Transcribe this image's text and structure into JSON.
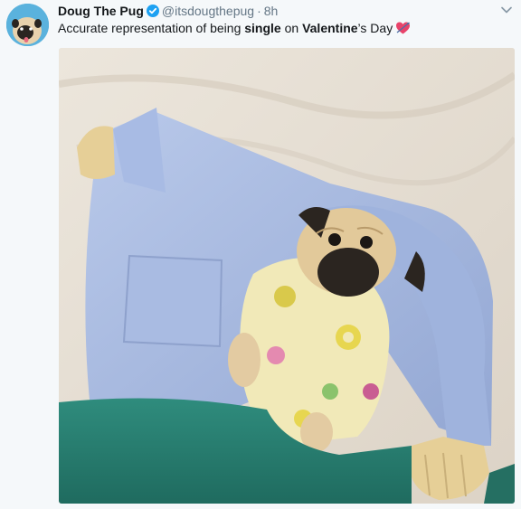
{
  "tweet": {
    "display_name": "Doug The Pug",
    "handle": "@itsdougthepug",
    "separator": "·",
    "time": "8h",
    "text": {
      "part1": "Accurate representation of being ",
      "single": "single",
      "part2": " on ",
      "valentine": "Valentine",
      "part3": "’s Day"
    },
    "icons": {
      "verified": "verified-badge-icon",
      "menu": "chevron-down-icon",
      "emoji": "heart-with-arrow-emoji"
    }
  },
  "colors": {
    "background": "#f5f8fa",
    "verified": "#1da1f2",
    "muted": "#657786",
    "text": "#14171a"
  }
}
